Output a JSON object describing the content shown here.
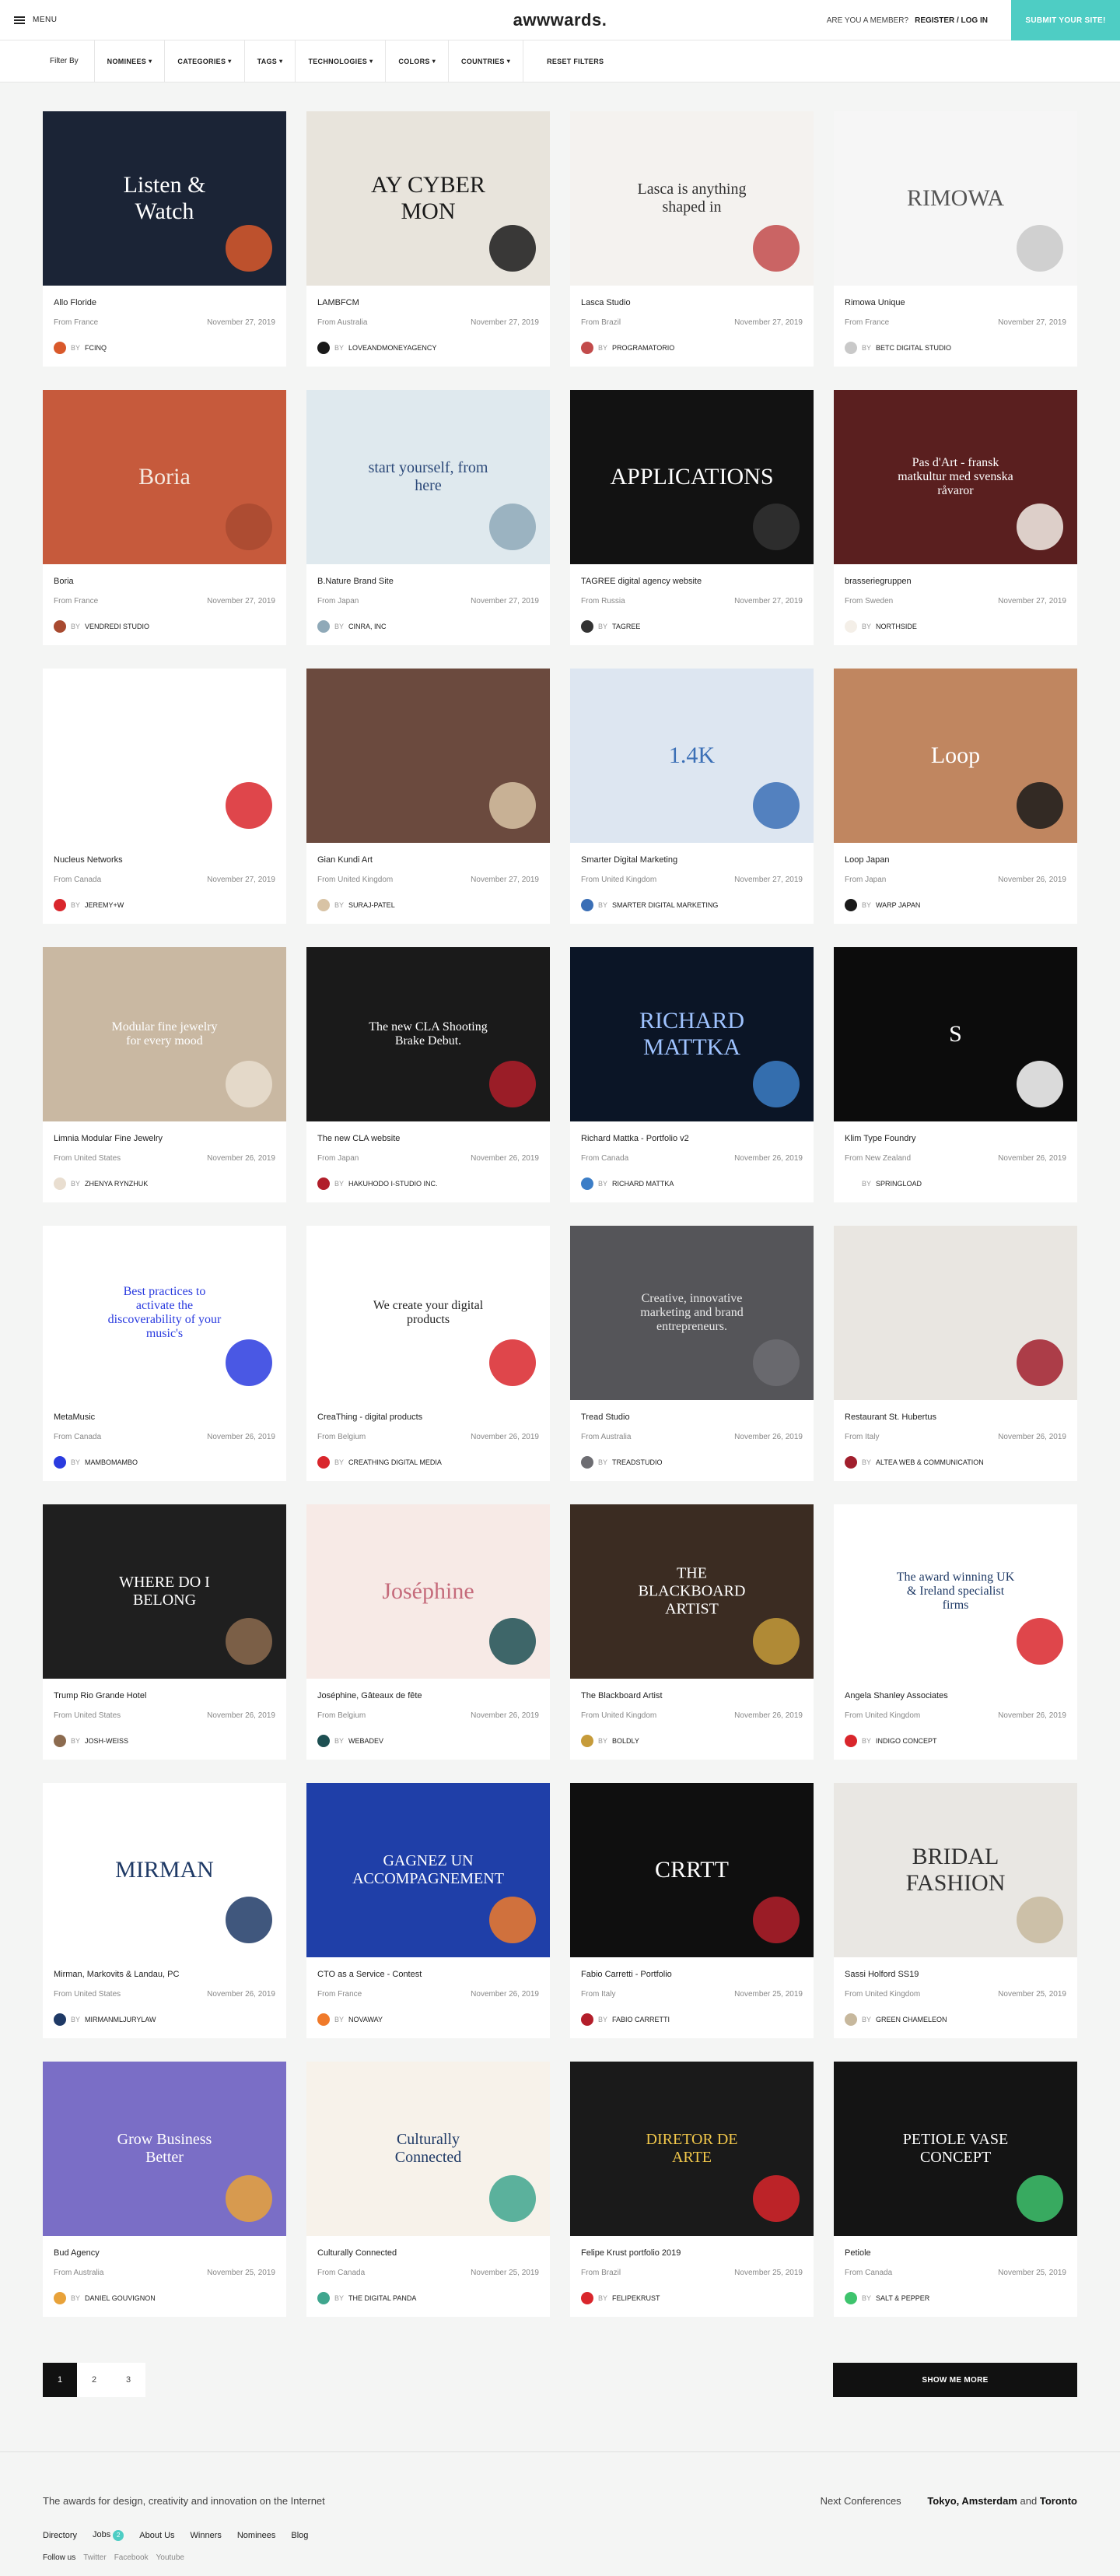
{
  "header": {
    "menu_label": "MENU",
    "logo": "awwwards.",
    "member_text": "ARE YOU A MEMBER?",
    "register_login": "REGISTER / LOG IN",
    "submit_label": "SUBMIT YOUR SITE!"
  },
  "filters": {
    "label": "Filter By",
    "items": [
      "NOMINEES",
      "CATEGORIES",
      "TAGS",
      "TECHNOLOGIES",
      "COLORS",
      "COUNTRIES"
    ],
    "reset": "RESET FILTERS"
  },
  "cards": [
    {
      "title": "Allo Floride",
      "from": "From France",
      "date": "November 27, 2019",
      "author": "FCINQ",
      "bg": "#1b2436",
      "accent": "#d9592b",
      "thumb_text": "Listen & Watch",
      "thumb_color": "#ffffff"
    },
    {
      "title": "LAMBFCM",
      "from": "From Australia",
      "date": "November 27, 2019",
      "author": "LOVEANDMONEYAGENCY",
      "bg": "#e8e4dc",
      "accent": "#1a1a1a",
      "thumb_text": "AY CYBER MON",
      "thumb_color": "#1a1a1a"
    },
    {
      "title": "Lasca Studio",
      "from": "From Brazil",
      "date": "November 27, 2019",
      "author": "PROGRAMATORIO",
      "bg": "#f4f2ef",
      "accent": "#c24b4b",
      "thumb_text": "Lasca is anything shaped in",
      "thumb_color": "#333333"
    },
    {
      "title": "Rimowa Unique",
      "from": "From France",
      "date": "November 27, 2019",
      "author": "BETC DIGITAL STUDIO",
      "bg": "#f6f6f6",
      "accent": "#c9c9c9",
      "thumb_text": "RIMOWA",
      "thumb_color": "#555555"
    },
    {
      "title": "Boria",
      "from": "From France",
      "date": "November 27, 2019",
      "author": "VENDREDI STUDIO",
      "bg": "#c65a3c",
      "accent": "#a84a30",
      "thumb_text": "Boria",
      "thumb_color": "#f5e9e0"
    },
    {
      "title": "B.Nature Brand Site",
      "from": "From Japan",
      "date": "November 27, 2019",
      "author": "CINRA, INC",
      "bg": "#dfe9ee",
      "accent": "#8fa9b8",
      "thumb_text": "start yourself, from here",
      "thumb_color": "#2d4a7a"
    },
    {
      "title": "TAGREE digital agency website",
      "from": "From Russia",
      "date": "November 27, 2019",
      "author": "TAGREE",
      "bg": "#121212",
      "accent": "#333333",
      "thumb_text": "APPLICATIONS",
      "thumb_color": "#ffffff"
    },
    {
      "title": "brasseriegruppen",
      "from": "From Sweden",
      "date": "November 27, 2019",
      "author": "NORTHSIDE",
      "bg": "#5a1f1f",
      "accent": "#f4efe8",
      "thumb_text": "Pas d'Art - fransk matkultur med svenska råvaror",
      "thumb_color": "#ffffff"
    },
    {
      "title": "Nucleus Networks",
      "from": "From Canada",
      "date": "November 27, 2019",
      "author": "JEREMY+W",
      "bg": "#ffffff",
      "accent": "#d9262c",
      "thumb_text": "",
      "thumb_color": "#111111"
    },
    {
      "title": "Gian Kundi Art",
      "from": "From United Kingdom",
      "date": "November 27, 2019",
      "author": "SURAJ-PATEL",
      "bg": "#6b4a3e",
      "accent": "#d8c3a5",
      "thumb_text": "",
      "thumb_color": "#ffffff"
    },
    {
      "title": "Smarter Digital Marketing",
      "from": "From United Kingdom",
      "date": "November 27, 2019",
      "author": "SMARTER DIGITAL MARKETING",
      "bg": "#dde6f1",
      "accent": "#3b6fb6",
      "thumb_text": "1.4K",
      "thumb_color": "#3b6fb6"
    },
    {
      "title": "Loop Japan",
      "from": "From Japan",
      "date": "November 26, 2019",
      "author": "WARP JAPAN",
      "bg": "#c08660",
      "accent": "#1a1a1a",
      "thumb_text": "Loop",
      "thumb_color": "#ffffff"
    },
    {
      "title": "Limnia Modular Fine Jewelry",
      "from": "From United States",
      "date": "November 26, 2019",
      "author": "ZHENYA RYNZHUK",
      "bg": "#c9b8a2",
      "accent": "#e9ded0",
      "thumb_text": "Modular fine jewelry for every mood",
      "thumb_color": "#ffffff"
    },
    {
      "title": "The new CLA website",
      "from": "From Japan",
      "date": "November 26, 2019",
      "author": "HAKUHODO I-STUDIO INC.",
      "bg": "#1a1a1a",
      "accent": "#b11e2a",
      "thumb_text": "The new CLA Shooting Brake Debut.",
      "thumb_color": "#ffffff"
    },
    {
      "title": "Richard Mattka - Portfolio v2",
      "from": "From Canada",
      "date": "November 26, 2019",
      "author": "RICHARD MATTKA",
      "bg": "#0b1526",
      "accent": "#3c7ec7",
      "thumb_text": "RICHARD MATTKA",
      "thumb_color": "#9fc3ff"
    },
    {
      "title": "Klim Type Foundry",
      "from": "From New Zealand",
      "date": "November 26, 2019",
      "author": "SPRINGLOAD",
      "bg": "#0c0c0c",
      "accent": "#ffffff",
      "thumb_text": "S",
      "thumb_color": "#ffffff"
    },
    {
      "title": "MetaMusic",
      "from": "From Canada",
      "date": "November 26, 2019",
      "author": "MAMBOMAMBO",
      "bg": "#ffffff",
      "accent": "#2a3bdf",
      "thumb_text": "Best practices to activate the discoverability of your music's",
      "thumb_color": "#2a3bdf"
    },
    {
      "title": "CreaThing - digital products",
      "from": "From Belgium",
      "date": "November 26, 2019",
      "author": "CREATHING DIGITAL MEDIA",
      "bg": "#ffffff",
      "accent": "#d9262c",
      "thumb_text": "We create your digital products",
      "thumb_color": "#222222"
    },
    {
      "title": "Tread Studio",
      "from": "From Australia",
      "date": "November 26, 2019",
      "author": "TREADSTUDIO",
      "bg": "#555559",
      "accent": "#6d6d72",
      "thumb_text": "Creative, innovative marketing and brand entrepreneurs.",
      "thumb_color": "#e8e8e8"
    },
    {
      "title": "Restaurant St. Hubertus",
      "from": "From Italy",
      "date": "November 26, 2019",
      "author": "ALTEA WEB & COMMUNICATION",
      "bg": "#e9e6e1",
      "accent": "#a11f2d",
      "thumb_text": "",
      "thumb_color": "#333333"
    },
    {
      "title": "Trump Rio Grande Hotel",
      "from": "From United States",
      "date": "November 26, 2019",
      "author": "JOSH-WEISS",
      "bg": "#1f1f1f",
      "accent": "#8c6b4f",
      "thumb_text": "WHERE DO I BELONG",
      "thumb_color": "#ffffff"
    },
    {
      "title": "Joséphine, Gâteaux de fête",
      "from": "From Belgium",
      "date": "November 26, 2019",
      "author": "WEBADEV",
      "bg": "#f7eae6",
      "accent": "#1d4f52",
      "thumb_text": "Joséphine",
      "thumb_color": "#c56b7b"
    },
    {
      "title": "The Blackboard Artist",
      "from": "From United Kingdom",
      "date": "November 26, 2019",
      "author": "BOLDLY",
      "bg": "#3b2c22",
      "accent": "#c69b3a",
      "thumb_text": "THE BLACKBOARD ARTIST",
      "thumb_color": "#ffffff"
    },
    {
      "title": "Angela Shanley Associates",
      "from": "From United Kingdom",
      "date": "November 26, 2019",
      "author": "INDIGO CONCEPT",
      "bg": "#ffffff",
      "accent": "#d9262c",
      "thumb_text": "The award winning UK & Ireland specialist firms",
      "thumb_color": "#1f3a66"
    },
    {
      "title": "Mirman, Markovits & Landau, PC",
      "from": "From United States",
      "date": "November 26, 2019",
      "author": "MIRMANMLJURYLAW",
      "bg": "#ffffff",
      "accent": "#1f3a66",
      "thumb_text": "MIRMAN",
      "thumb_color": "#1f3a66"
    },
    {
      "title": "CTO as a Service - Contest",
      "from": "From France",
      "date": "November 26, 2019",
      "author": "NOVAWAY",
      "bg": "#1f3fa8",
      "accent": "#f07a2a",
      "thumb_text": "GAGNEZ UN ACCOMPAGNEMENT",
      "thumb_color": "#ffffff"
    },
    {
      "title": "Fabio Carretti - Portfolio",
      "from": "From Italy",
      "date": "November 25, 2019",
      "author": "FABIO CARRETTI",
      "bg": "#0f0f0f",
      "accent": "#b31e2a",
      "thumb_text": "CRRTT",
      "thumb_color": "#ffffff"
    },
    {
      "title": "Sassi Holford SS19",
      "from": "From United Kingdom",
      "date": "November 25, 2019",
      "author": "GREEN CHAMELEON",
      "bg": "#e9e7e3",
      "accent": "#c7b89d",
      "thumb_text": "BRIDAL FASHION",
      "thumb_color": "#333333"
    },
    {
      "title": "Bud Agency",
      "from": "From Australia",
      "date": "November 25, 2019",
      "author": "DANIEL GOUVIGNON",
      "bg": "#7a6ec6",
      "accent": "#e8a23a",
      "thumb_text": "Grow Business Better",
      "thumb_color": "#ffffff"
    },
    {
      "title": "Culturally Connected",
      "from": "From Canada",
      "date": "November 25, 2019",
      "author": "THE DIGITAL PANDA",
      "bg": "#f7f2ea",
      "accent": "#3fa68e",
      "thumb_text": "Culturally Connected",
      "thumb_color": "#1f3a66"
    },
    {
      "title": "Felipe Krust portfolio 2019",
      "from": "From Brazil",
      "date": "November 25, 2019",
      "author": "FELIPEKRUST",
      "bg": "#1a1a1a",
      "accent": "#d9262c",
      "thumb_text": "DIRETOR DE ARTE",
      "thumb_color": "#f2c84b"
    },
    {
      "title": "Petiole",
      "from": "From Canada",
      "date": "November 25, 2019",
      "author": "SALT & PEPPER",
      "bg": "#141414",
      "accent": "#3ec46d",
      "thumb_text": "PETIOLE VASE CONCEPT",
      "thumb_color": "#ffffff"
    }
  ],
  "pagination": {
    "pages": [
      "1",
      "2",
      "3"
    ],
    "show_more": "SHOW ME MORE"
  },
  "footer": {
    "tagline": "The awards for design, creativity and innovation on the Internet",
    "next_conf_label": "Next Conferences",
    "conf_cities": "Tokyo, Amsterdam",
    "conf_and": "and",
    "conf_last": "Toronto",
    "links": [
      "Directory",
      "Jobs",
      "About Us",
      "Winners",
      "Nominees",
      "Blog"
    ],
    "jobs_count": "2",
    "follow_label": "Follow us",
    "social": [
      "Twitter",
      "Facebook",
      "Youtube"
    ]
  }
}
